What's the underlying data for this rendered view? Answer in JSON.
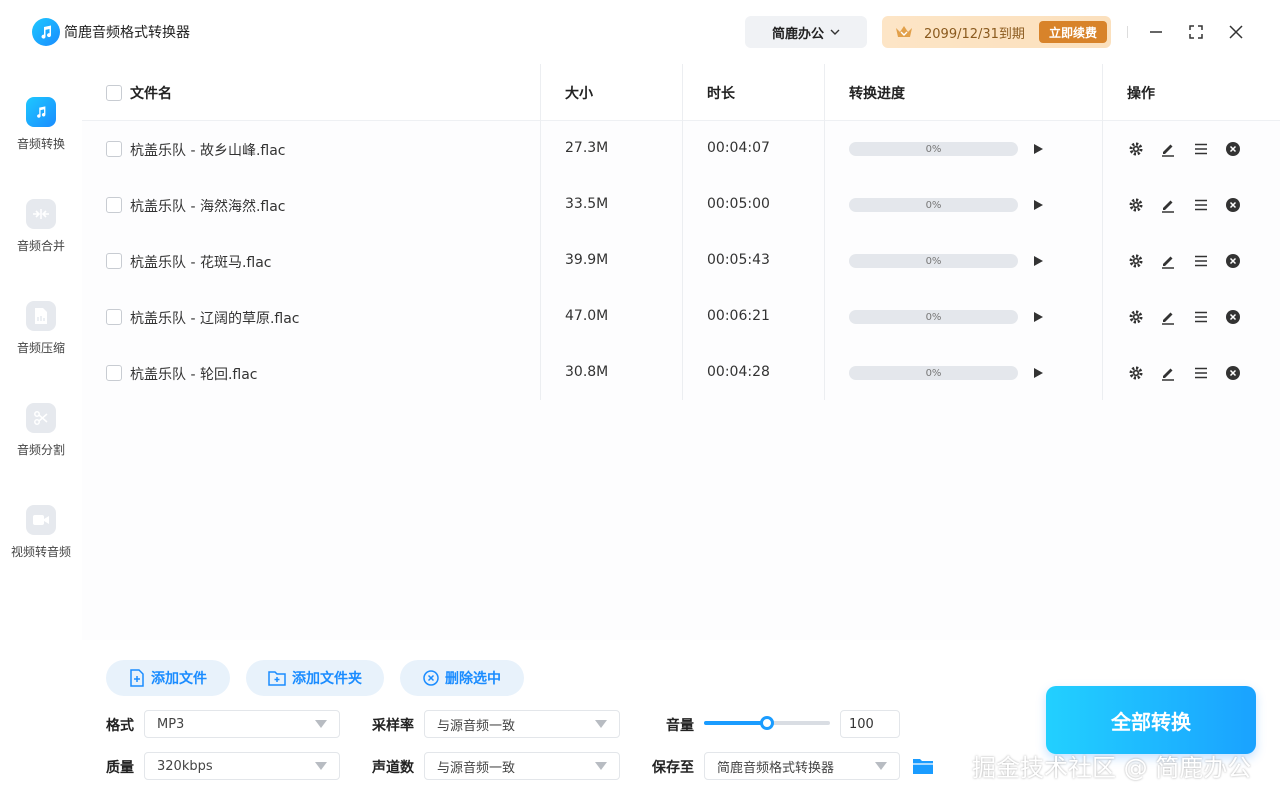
{
  "app": {
    "title": "简鹿音频格式转换器"
  },
  "header": {
    "brand_menu": "简鹿办公",
    "vip_expire": "2099/12/31到期",
    "renew_label": "立即续费"
  },
  "sidebar": {
    "items": [
      {
        "label": "音频转换",
        "icon": "music-note-icon",
        "active": true
      },
      {
        "label": "音频合并",
        "icon": "merge-icon",
        "active": false
      },
      {
        "label": "音频压缩",
        "icon": "compress-icon",
        "active": false
      },
      {
        "label": "音频分割",
        "icon": "scissors-icon",
        "active": false
      },
      {
        "label": "视频转音频",
        "icon": "video-camera-icon",
        "active": false
      }
    ]
  },
  "table": {
    "headers": {
      "name": "文件名",
      "size": "大小",
      "duration": "时长",
      "progress": "转换进度",
      "actions": "操作"
    },
    "rows": [
      {
        "name": "杭盖乐队 - 故乡山峰.flac",
        "size": "27.3M",
        "duration": "00:04:07",
        "progress": "0%"
      },
      {
        "name": "杭盖乐队 - 海然海然.flac",
        "size": "33.5M",
        "duration": "00:05:00",
        "progress": "0%"
      },
      {
        "name": "杭盖乐队 - 花斑马.flac",
        "size": "39.9M",
        "duration": "00:05:43",
        "progress": "0%"
      },
      {
        "name": "杭盖乐队 - 辽阔的草原.flac",
        "size": "47.0M",
        "duration": "00:06:21",
        "progress": "0%"
      },
      {
        "name": "杭盖乐队 - 轮回.flac",
        "size": "30.8M",
        "duration": "00:04:28",
        "progress": "0%"
      }
    ]
  },
  "toolbar": {
    "add_file": "添加文件",
    "add_folder": "添加文件夹",
    "delete_selected": "删除选中"
  },
  "settings": {
    "format_label": "格式",
    "format_value": "MP3",
    "quality_label": "质量",
    "quality_value": "320kbps",
    "sample_rate_label": "采样率",
    "sample_rate_value": "与源音频一致",
    "channels_label": "声道数",
    "channels_value": "与源音频一致",
    "volume_label": "音量",
    "volume_value": "100",
    "volume_level": 0.5,
    "save_to_label": "保存至",
    "save_to_value": "简鹿音频格式转换器"
  },
  "convert_all_label": "全部转换",
  "watermark": "掘金技术社区 @ 简鹿办公",
  "colors": {
    "accent": "#1a8cff",
    "vip_bg": "#fde5c6",
    "renew_bg": "#d8832a"
  }
}
